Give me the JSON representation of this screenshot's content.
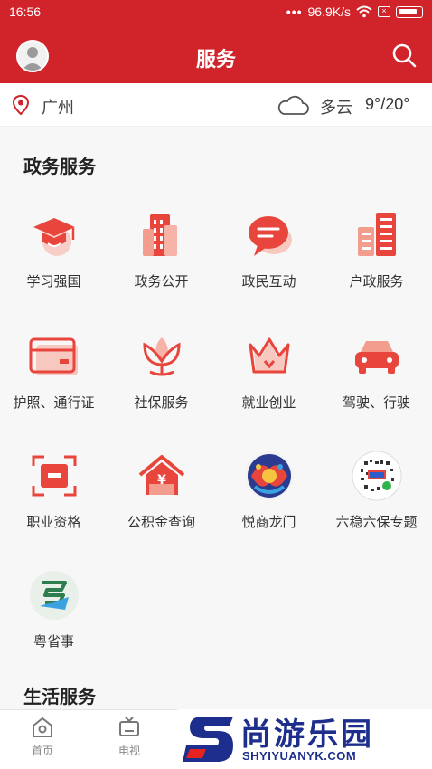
{
  "status_bar": {
    "time": "16:56",
    "network_speed": "96.9K/s",
    "dots": "•••"
  },
  "header": {
    "title": "服务"
  },
  "location": {
    "city": "广州",
    "weather": "多云",
    "temperature": "9°/20°"
  },
  "gov_section": {
    "title": "政务服务",
    "items": [
      {
        "label": "学习强国",
        "icon": "graduation-cap-icon"
      },
      {
        "label": "政务公开",
        "icon": "building-icon"
      },
      {
        "label": "政民互动",
        "icon": "chat-bubble-icon"
      },
      {
        "label": "户政服务",
        "icon": "buildings-icon"
      },
      {
        "label": "护照、通行证",
        "icon": "card-icon"
      },
      {
        "label": "社保服务",
        "icon": "lotus-icon"
      },
      {
        "label": "就业创业",
        "icon": "crown-icon"
      },
      {
        "label": "驾驶、行驶",
        "icon": "car-icon"
      },
      {
        "label": "职业资格",
        "icon": "scan-frame-icon"
      },
      {
        "label": "公积金查询",
        "icon": "house-yuan-icon"
      },
      {
        "label": "悦商龙门",
        "icon": "yueshang-logo"
      },
      {
        "label": "六稳六保专题",
        "icon": "qr-code-icon"
      },
      {
        "label": "粤省事",
        "icon": "yueshengshi-logo"
      }
    ]
  },
  "life_section": {
    "title": "生活服务"
  },
  "tab_bar": {
    "tabs": [
      {
        "label": "首页",
        "icon": "home-icon"
      },
      {
        "label": "电视",
        "icon": "tv-icon"
      }
    ]
  },
  "watermark": {
    "name": "尚游乐园",
    "url": "SHYIYUANYK.COM"
  },
  "colors": {
    "brand_red": "#d0232a",
    "icon_red": "#e8453c",
    "icon_light": "#f7b3a8",
    "watermark_blue": "#1d2e8c"
  }
}
